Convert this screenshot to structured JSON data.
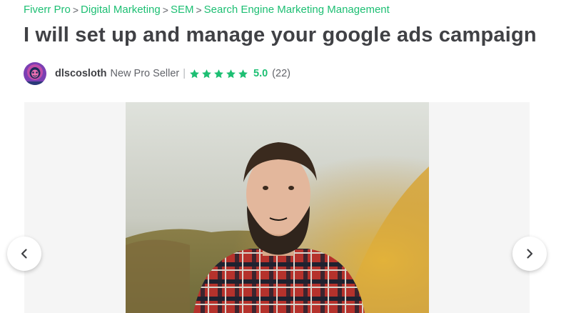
{
  "breadcrumbs": [
    {
      "label": "Fiverr Pro"
    },
    {
      "label": "Digital Marketing"
    },
    {
      "label": "SEM"
    },
    {
      "label": "Search Engine Marketing Management"
    }
  ],
  "breadcrumb_separator": ">",
  "gig": {
    "title": "I will set up and manage your google ads campaign"
  },
  "seller": {
    "username": "dlscosloth",
    "level": "New Pro Seller",
    "divider": "|",
    "rating": "5.0",
    "reviews": "(22)",
    "stars_filled": 5,
    "avatar_icon": "avatar-sloth"
  },
  "gallery": {
    "image_description_icon": "seller-photo",
    "prev_icon": "chevron-left-icon",
    "next_icon": "chevron-right-icon"
  },
  "colors": {
    "brand_green": "#1dbf73",
    "text_dark": "#404145",
    "text_muted": "#62646a",
    "gallery_bg": "#f5f5f5"
  }
}
